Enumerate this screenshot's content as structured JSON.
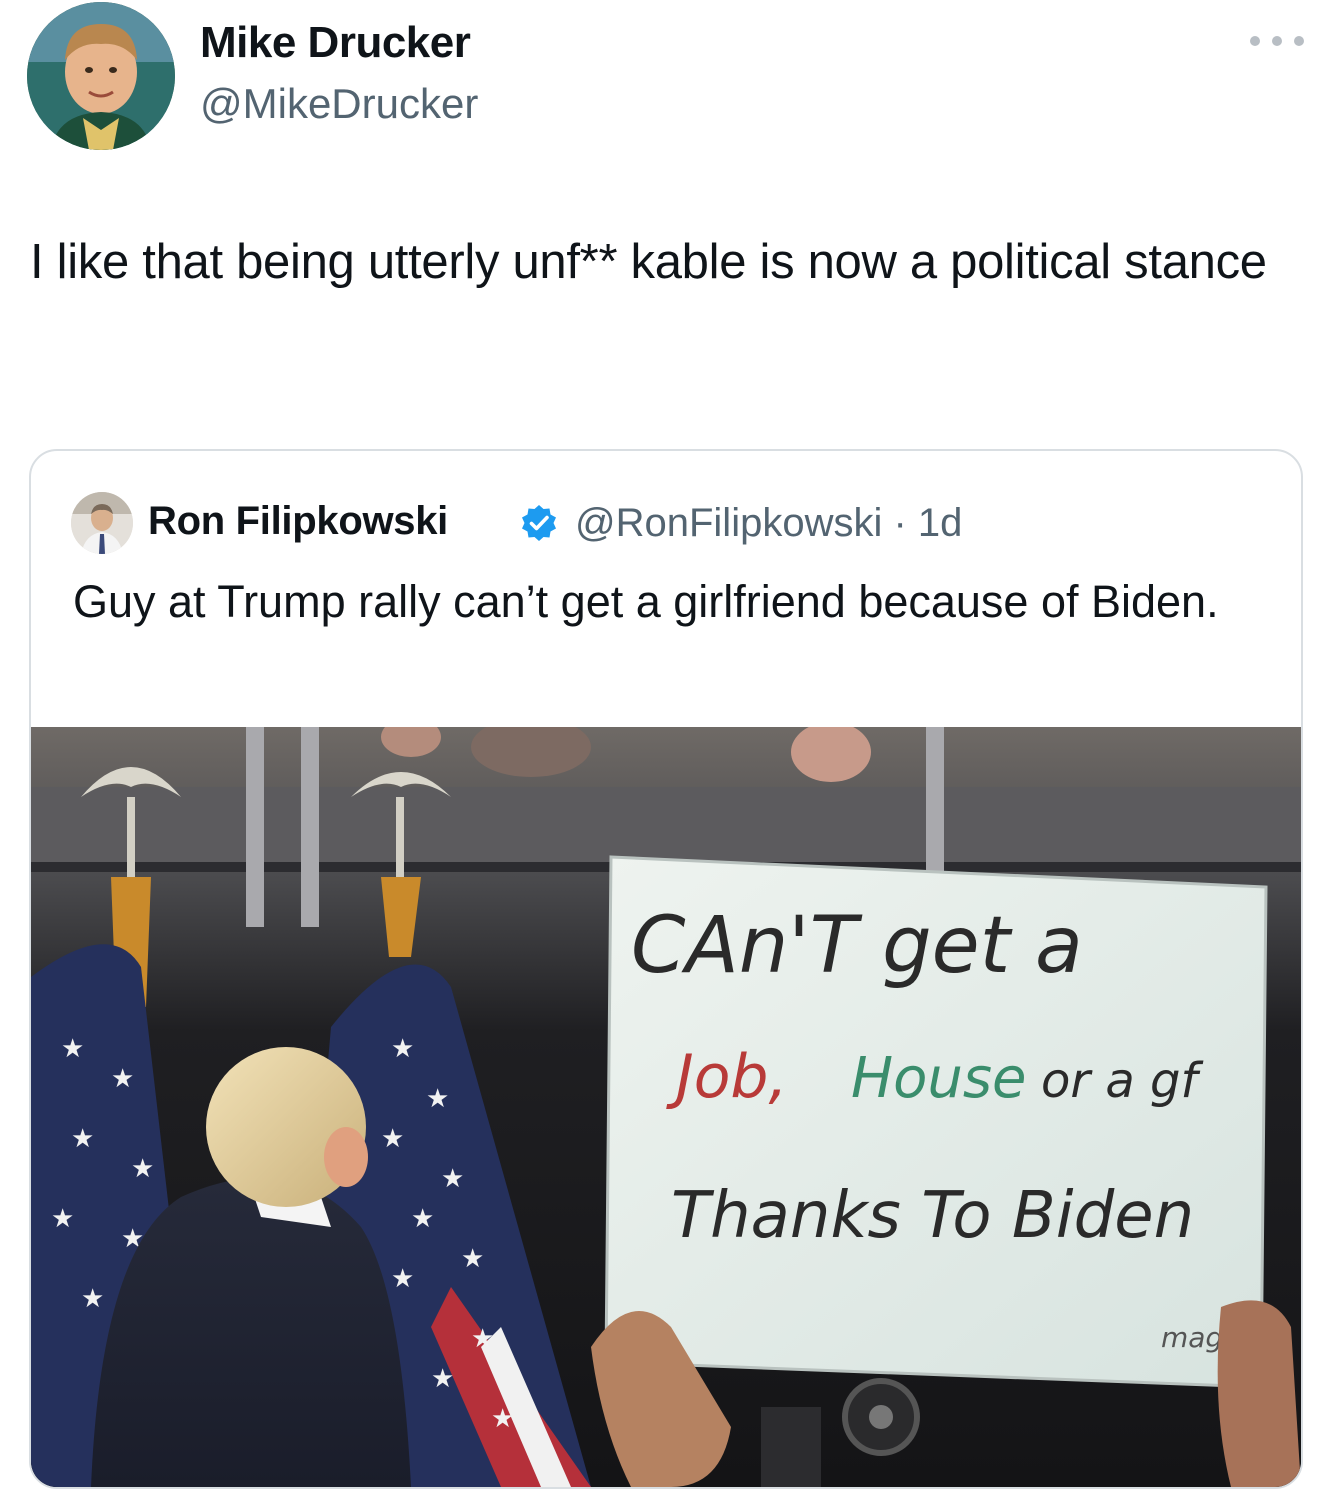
{
  "tweet": {
    "author": {
      "name": "Mike Drucker",
      "handle": "@MikeDrucker",
      "avatar_icon": "profile-photo-child"
    },
    "more_icon": "ellipsis-icon",
    "text": "I like that being utterly unf** kable is now a political stance"
  },
  "quote": {
    "author": {
      "name": "Ron Filipkowski",
      "handle_and_time": "@RonFilipkowski · 1d",
      "verified_icon": "verified-badge-icon",
      "avatar_icon": "profile-photo-man"
    },
    "text": "Guy at Trump rally can’t get a girlfriend because of Biden.",
    "media": {
      "sign": {
        "line1": "CAn'T get a",
        "line2_job": "Job,",
        "line2_house": "House",
        "line2_rest": "or a gf",
        "line3": "Thanks To Biden",
        "signature": "maga"
      }
    }
  },
  "colors": {
    "text_primary": "#0f1419",
    "text_secondary": "#536471",
    "verified_blue": "#1d9bf0",
    "border": "#d9dee2"
  }
}
